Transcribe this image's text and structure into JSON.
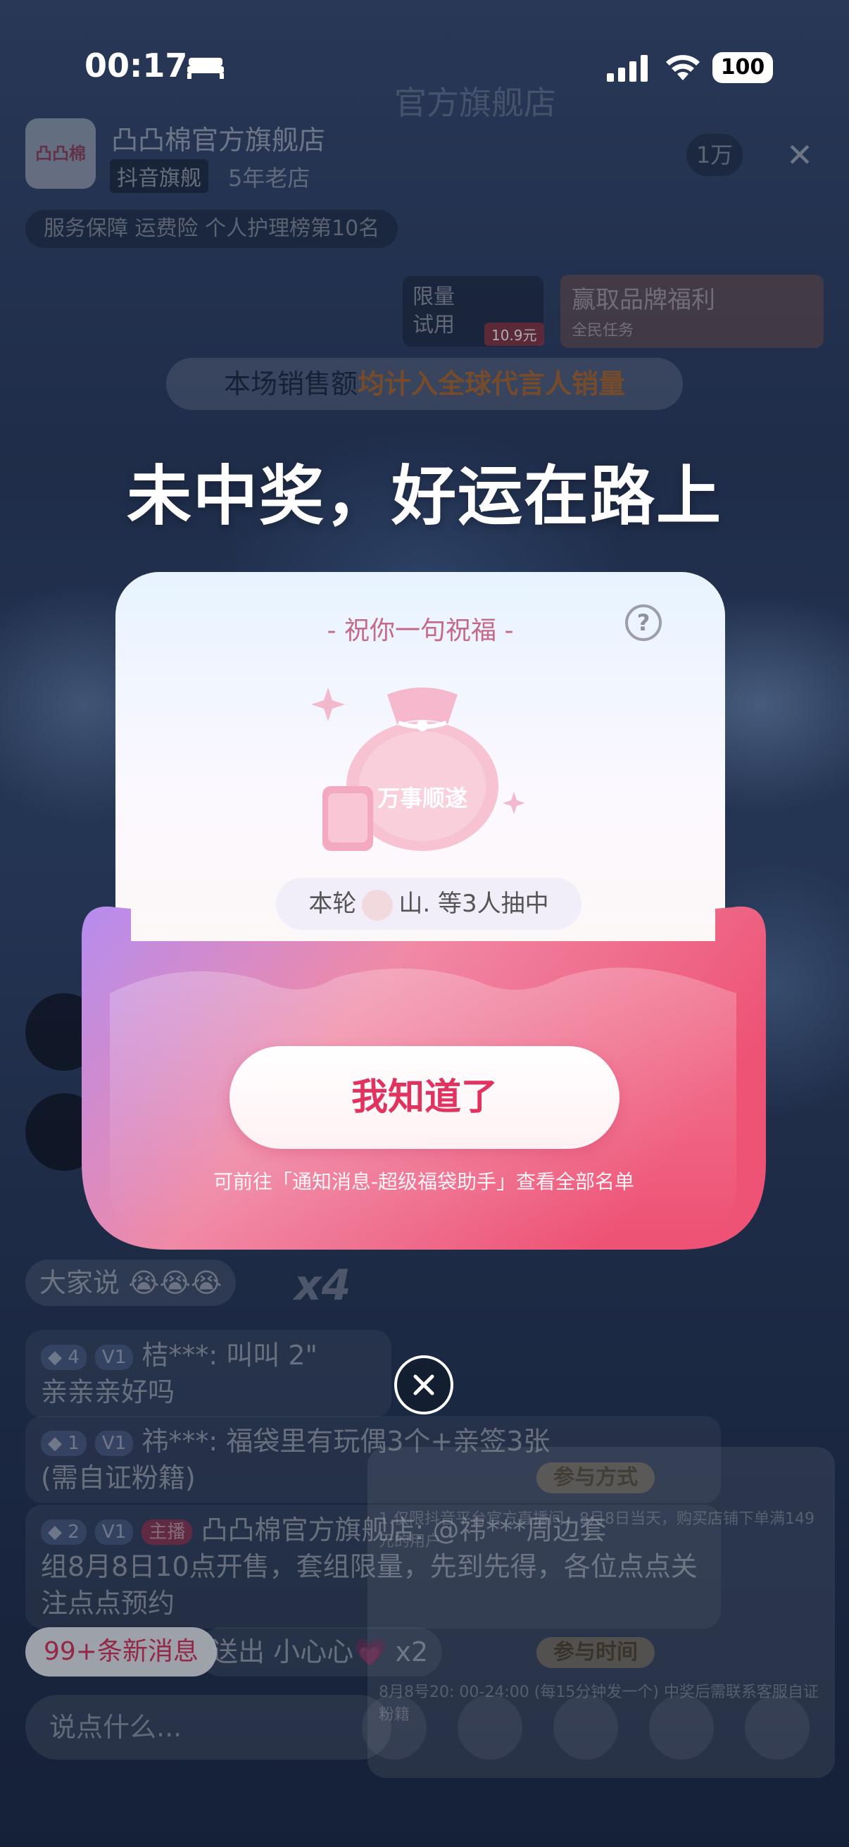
{
  "status_bar": {
    "time": "00:17",
    "battery": "100"
  },
  "header": {
    "store_logo_text": "凸凸棉",
    "store_name": "凸凸棉官方旗舰店",
    "store_badge": "抖音旗舰",
    "store_age": "5年老店",
    "brand_banner": "官方旗舰店",
    "viewer_count": "1万",
    "service_tags": "服务保障 运费险  个人护理榜第10名",
    "trial": {
      "line1": "限量",
      "line2": "试用",
      "price": "10.9元"
    },
    "welfare": {
      "title": "赢取品牌福利",
      "subtitle": "全民任务"
    }
  },
  "sales_banner": {
    "prefix": "本场销售额",
    "highlight": "均计入全球代言人销量"
  },
  "modal": {
    "headline": "未中奖，好运在路上",
    "card_title": "祝你一句祝福",
    "bag_text": "万事顺遂",
    "winners_prefix": "本轮",
    "winners_suffix": "山. 等3人抽中",
    "confirm_button": "我知道了",
    "hint": "可前往「通知消息-超级福袋助手」查看全部名单"
  },
  "chat": {
    "tag_text": "大家说 😭😭😭",
    "tag_count": "x4",
    "messages": [
      {
        "level": "4",
        "badge": "V1",
        "user": "桔***:",
        "text": "叫叫 2\"",
        "body": "亲亲亲好吗"
      },
      {
        "level": "1",
        "badge": "V1",
        "user": "祎***:",
        "text": "福袋里有玩偶3个+亲签3张",
        "body": "(需自证粉籍)"
      },
      {
        "level": "2",
        "badge": "V1",
        "host": "主播",
        "user": "凸凸棉官方旗舰店:",
        "text": "@祎***周边套",
        "body": "组8月8日10点开售，套组限量，先到先得，各位点点关注点点预约"
      }
    ],
    "new_messages": "99+条新消息",
    "love_text": "送出 小心心💗 x2",
    "input_placeholder": "说点什么..."
  },
  "rules_panel": {
    "label1": "参与方式",
    "label2": "参与时间",
    "text1": "1.仅限抖音平台官方直播间，8月8日当天，购买店铺下单满149元的用户",
    "text2": "8月8号20: 00-24:00 (每15分钟发一个) 中奖后需联系客服自证粉籍"
  }
}
